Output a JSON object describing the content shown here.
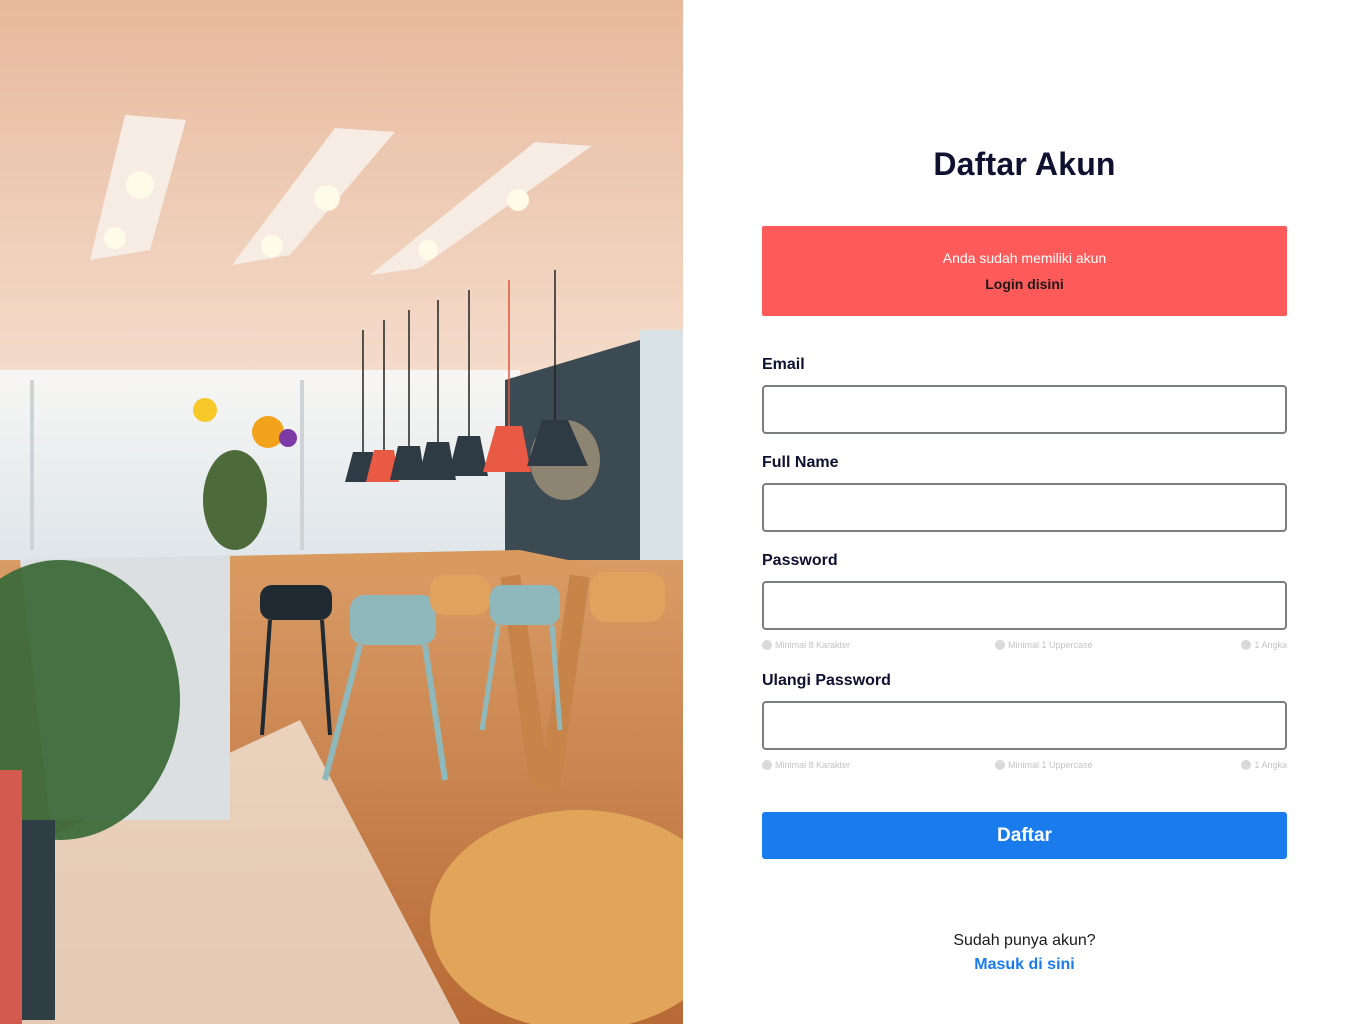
{
  "hero": {
    "image": "office-cafe-interior-photo"
  },
  "form": {
    "title": "Daftar Akun",
    "alert": {
      "message": "Anda sudah memiliki akun",
      "link": "Login disini",
      "color": "#ff5a5a"
    },
    "fields": {
      "email": {
        "label": "Email",
        "value": "",
        "placeholder": ""
      },
      "full_name": {
        "label": "Full Name",
        "value": "",
        "placeholder": ""
      },
      "password": {
        "label": "Password",
        "value": "",
        "placeholder": "",
        "hints": [
          "Minimal 8 Karakter",
          "Minimal 1 Uppercase",
          "1 Angka"
        ]
      },
      "confirm_password": {
        "label": "Ulangi Password",
        "value": "",
        "placeholder": "",
        "hints": [
          "Minimal 8 Karakter",
          "Minimal 1 Uppercase",
          "1 Angka"
        ]
      }
    },
    "submit_label": "Daftar",
    "submit_color": "#1a7cec",
    "footer": {
      "question": "Sudah punya akun?",
      "link": "Masuk di sini"
    }
  }
}
